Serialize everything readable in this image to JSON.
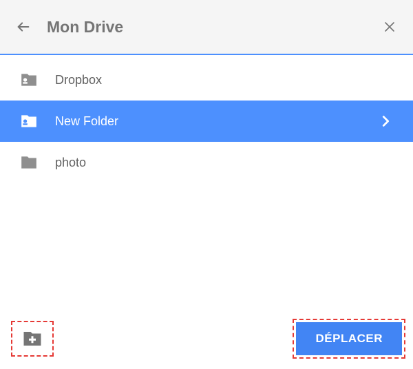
{
  "header": {
    "title": "Mon Drive"
  },
  "folders": [
    {
      "name": "Dropbox",
      "type": "special",
      "selected": false
    },
    {
      "name": "New Folder",
      "type": "special",
      "selected": true
    },
    {
      "name": "photo",
      "type": "plain",
      "selected": false
    }
  ],
  "footer": {
    "move_label": "DÉPLACER"
  }
}
